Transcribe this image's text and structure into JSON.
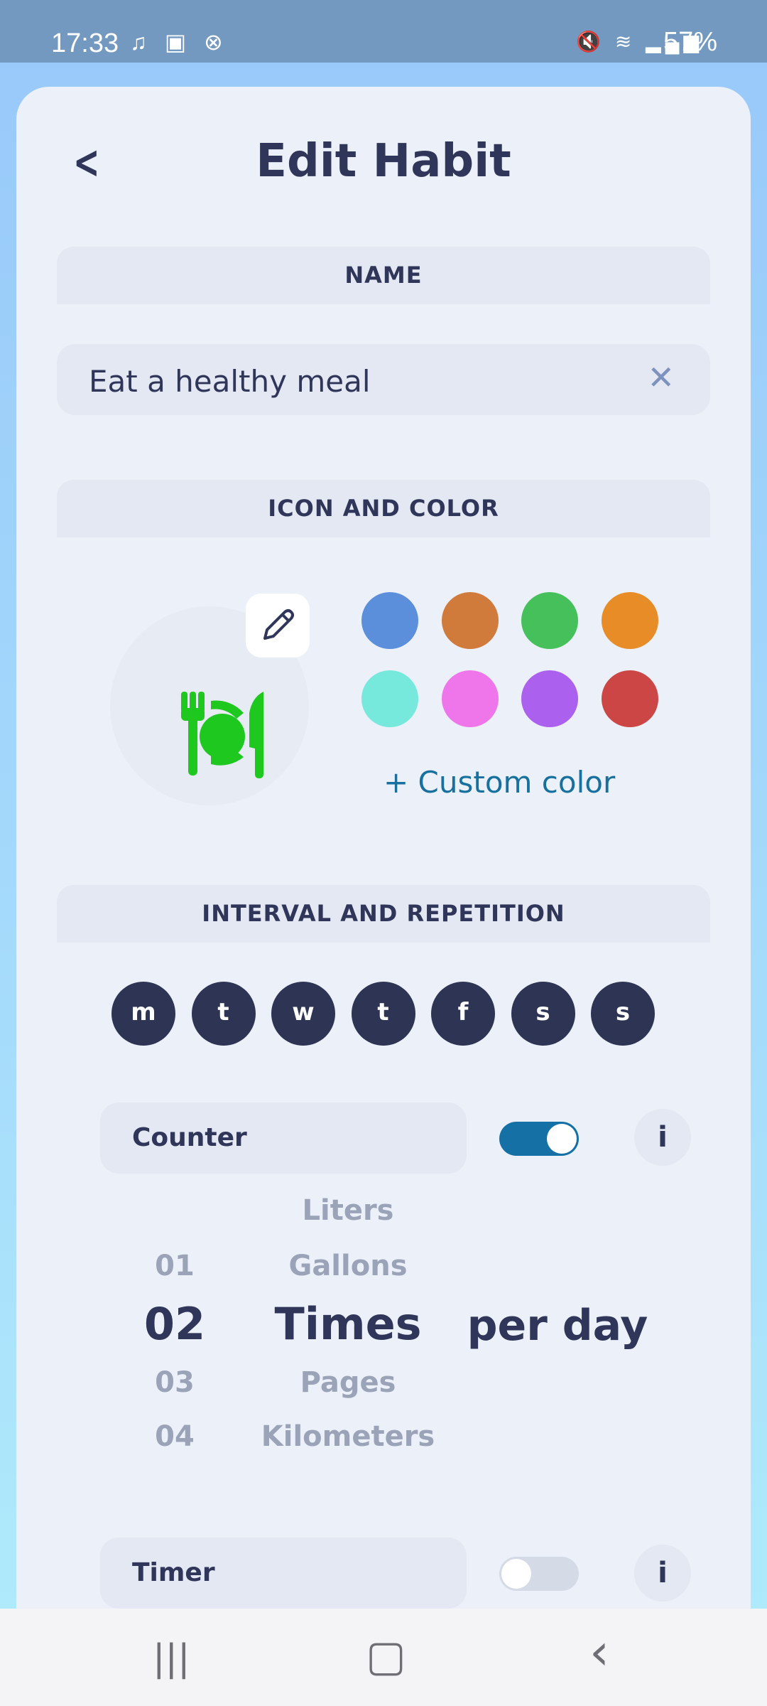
{
  "status_bar": {
    "time": "17:33",
    "left_icons": [
      "music-lock-icon",
      "image-icon",
      "x-icon"
    ],
    "right_icons": [
      "mute-icon",
      "wifi-6-icon",
      "volte-lte1-icon",
      "signal-icon"
    ],
    "battery": "57%"
  },
  "header": {
    "title": "Edit Habit",
    "back_icon": "chevron-left-icon"
  },
  "name_section": {
    "label": "NAME",
    "value": "Eat a healthy meal",
    "clear_icon": "close-icon"
  },
  "icon_section": {
    "label": "ICON AND COLOR",
    "icon": "utensils-plate-icon",
    "icon_color": "#1ec81e",
    "edit_icon": "pencil-icon",
    "colors": [
      "#5b8fdc",
      "#d07a3c",
      "#45c05a",
      "#e88c28",
      "#76e8dc",
      "#ee76ea",
      "#ab60ee",
      "#cc4646"
    ],
    "custom_color": "+ Custom color"
  },
  "interval_section": {
    "label": "INTERVAL AND REPETITION",
    "days": [
      "m",
      "t",
      "w",
      "t",
      "f",
      "s",
      "s"
    ]
  },
  "counter": {
    "label": "Counter",
    "enabled": true,
    "accent": "#1570a6",
    "numbers": [
      "01",
      "02",
      "03",
      "04"
    ],
    "selected_number": "02",
    "units": [
      "Liters",
      "Gallons",
      "Times",
      "Pages",
      "Kilometers"
    ],
    "selected_unit": "Times",
    "period": "per day"
  },
  "timer": {
    "label": "Timer",
    "enabled": false
  },
  "nav": {
    "recents": "|||",
    "home": "▢",
    "back": "‹"
  }
}
